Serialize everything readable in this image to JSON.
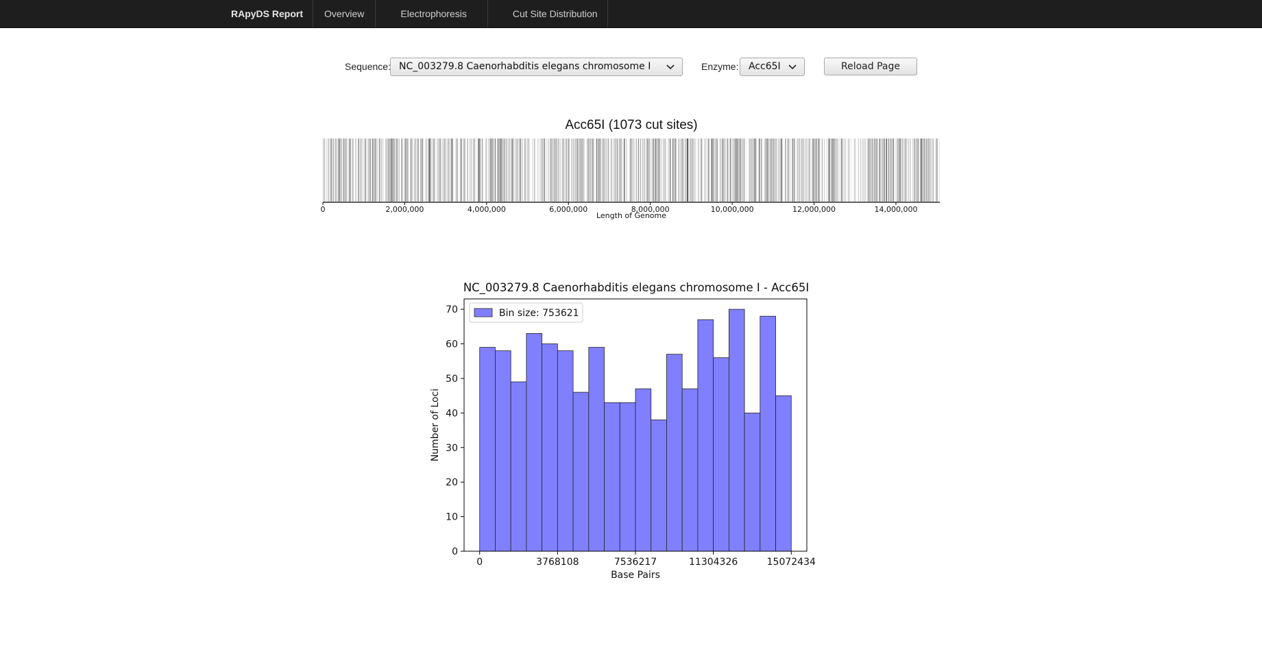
{
  "navbar": {
    "brand": "RApyDS Report",
    "links": [
      "Overview",
      "Electrophoresis",
      "Cut Site Distribution"
    ]
  },
  "controls": {
    "sequence_label": "Sequence:",
    "sequence_value": "NC_003279.8 Caenorhabditis elegans chromosome I",
    "enzyme_label": "Enzyme:",
    "enzyme_value": "Acc65I",
    "reload_label": "Reload Page"
  },
  "icons": {
    "dropdown": "chevron-down-icon"
  },
  "colors": {
    "navbar_bg": "#1e1e1e",
    "bar_fill": "#8080ff",
    "cut_line": "#000000"
  },
  "chart_data": [
    {
      "type": "cut-site-strip",
      "title": "Acc65I (1073 cut sites)",
      "xlabel": "Length of Genome",
      "xlim": [
        0,
        15072434
      ],
      "xticks": [
        0,
        2000000,
        4000000,
        6000000,
        8000000,
        10000000,
        12000000,
        14000000
      ],
      "xtick_labels": [
        "0",
        "2,000,000",
        "4,000,000",
        "6,000,000",
        "8,000,000",
        "10,000,000",
        "12,000,000",
        "14,000,000"
      ],
      "cut_site_count": 1073
    },
    {
      "type": "bar",
      "title": "NC_003279.8 Caenorhabditis elegans chromosome I - Acc65I",
      "xlabel": "Base Pairs",
      "ylabel": "Number of Loci",
      "legend": "Bin size: 753621",
      "legend_position": "top-left",
      "bin_size": 753621,
      "xlim": [
        -753621,
        15826055
      ],
      "ylim": [
        0,
        73
      ],
      "xticks": [
        0,
        3768108,
        7536217,
        11304326,
        15072434
      ],
      "yticks": [
        0,
        10,
        20,
        30,
        40,
        50,
        60,
        70
      ],
      "values": [
        59,
        58,
        49,
        63,
        60,
        58,
        46,
        59,
        43,
        43,
        47,
        38,
        57,
        47,
        67,
        56,
        70,
        40,
        68,
        45
      ]
    }
  ]
}
